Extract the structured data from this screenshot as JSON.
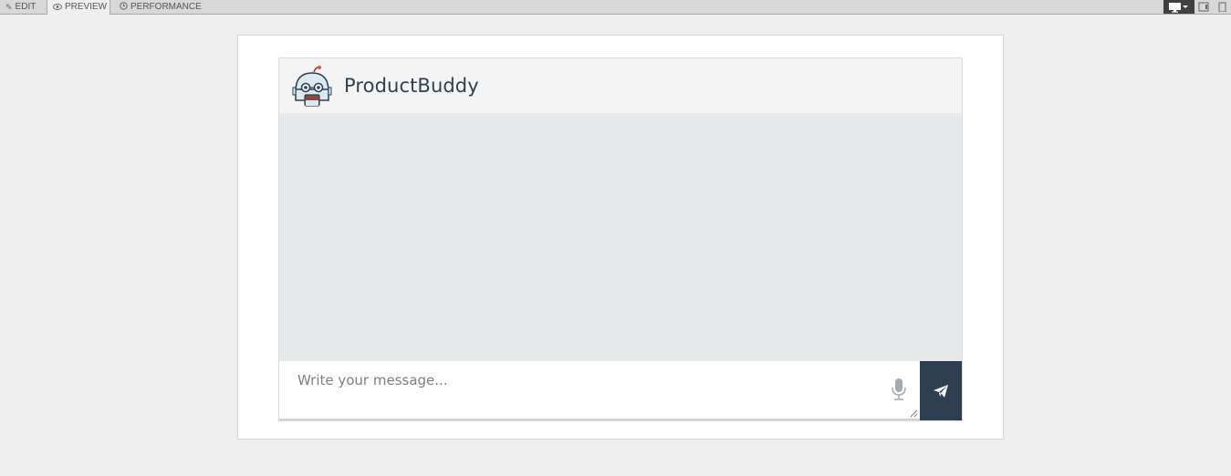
{
  "toolbar": {
    "tabs": [
      {
        "label": "EDIT",
        "icon": "edit-icon"
      },
      {
        "label": "PREVIEW",
        "icon": "eye-icon"
      },
      {
        "label": "PERFORMANCE",
        "icon": "clock-icon"
      }
    ],
    "active_tab": "PREVIEW",
    "devices": [
      "desktop-icon",
      "tablet-icon",
      "phone-icon"
    ]
  },
  "chat": {
    "bot_name": "ProductBuddy",
    "avatar_icon": "robot-avatar-icon",
    "input_placeholder": "Write your message...",
    "mic_icon": "microphone-icon",
    "send_icon": "paper-plane-icon"
  },
  "colors": {
    "header_bg": "#f4f4f4",
    "messages_bg": "#e6e9ea",
    "send_button_bg": "#2c3e50",
    "bot_name_color": "#2e4153"
  }
}
